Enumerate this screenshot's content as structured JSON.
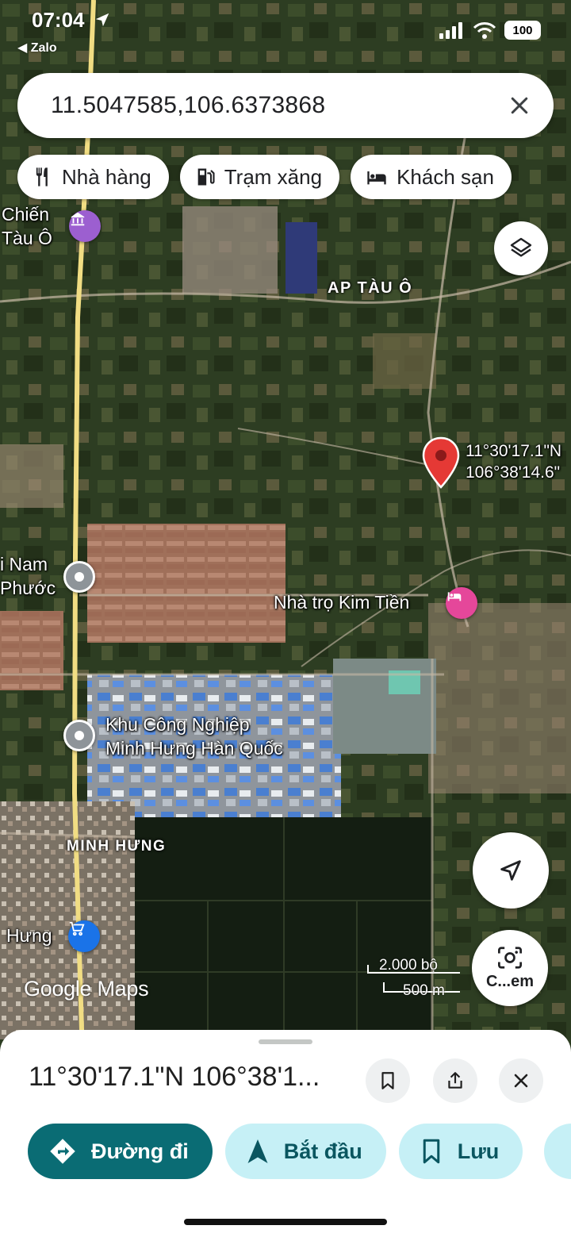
{
  "status_bar": {
    "time": "07:04",
    "back_app": "◀ Zalo",
    "battery": "100"
  },
  "search": {
    "query": "11.5047585,106.6373868"
  },
  "chips": [
    {
      "label": "Nhà hàng",
      "icon": "restaurant-icon"
    },
    {
      "label": "Trạm xăng",
      "icon": "gas-station-icon"
    },
    {
      "label": "Khách sạn",
      "icon": "hotel-icon"
    }
  ],
  "map": {
    "labels": {
      "chien_tau_o_1": "Chiến",
      "chien_tau_o_2": "Tàu Ô",
      "ap_tau_o": "AP TÀU Ô",
      "pin_coord_1": "11°30'17.1\"N",
      "pin_coord_2": "106°38'14.6\"",
      "nam_phuoc_1": "i Nam",
      "nam_phuoc_2": "Phước",
      "nha_tro": "Nhà trọ Kim Tiền",
      "kcn_1": "Khu Công Nghiệp",
      "kcn_2": "Minh Hưng Hàn Quốc",
      "minh_hung_area": "MINH HƯNG",
      "hung_shop": "Hưng"
    },
    "scale": {
      "imperial": "2.000 bộ",
      "metric": "500 m"
    },
    "logo": "Google Maps",
    "camera_label": "C...em",
    "colors": {
      "pin": "#e53935",
      "museum": "#9c5fd0",
      "hotel": "#e5479a",
      "shop": "#1a73e8",
      "road": "#f1dd83"
    }
  },
  "sheet": {
    "title": "11°30'17.1\"N 106°38'1...",
    "actions": [
      {
        "label": "Đường đi",
        "icon": "directions-icon"
      },
      {
        "label": "Bắt đầu",
        "icon": "navigation-arrow-icon"
      },
      {
        "label": "Lưu",
        "icon": "bookmark-icon"
      }
    ],
    "colors": {
      "primary": "#0a6c74",
      "secondary": "#c6f0f6"
    }
  }
}
